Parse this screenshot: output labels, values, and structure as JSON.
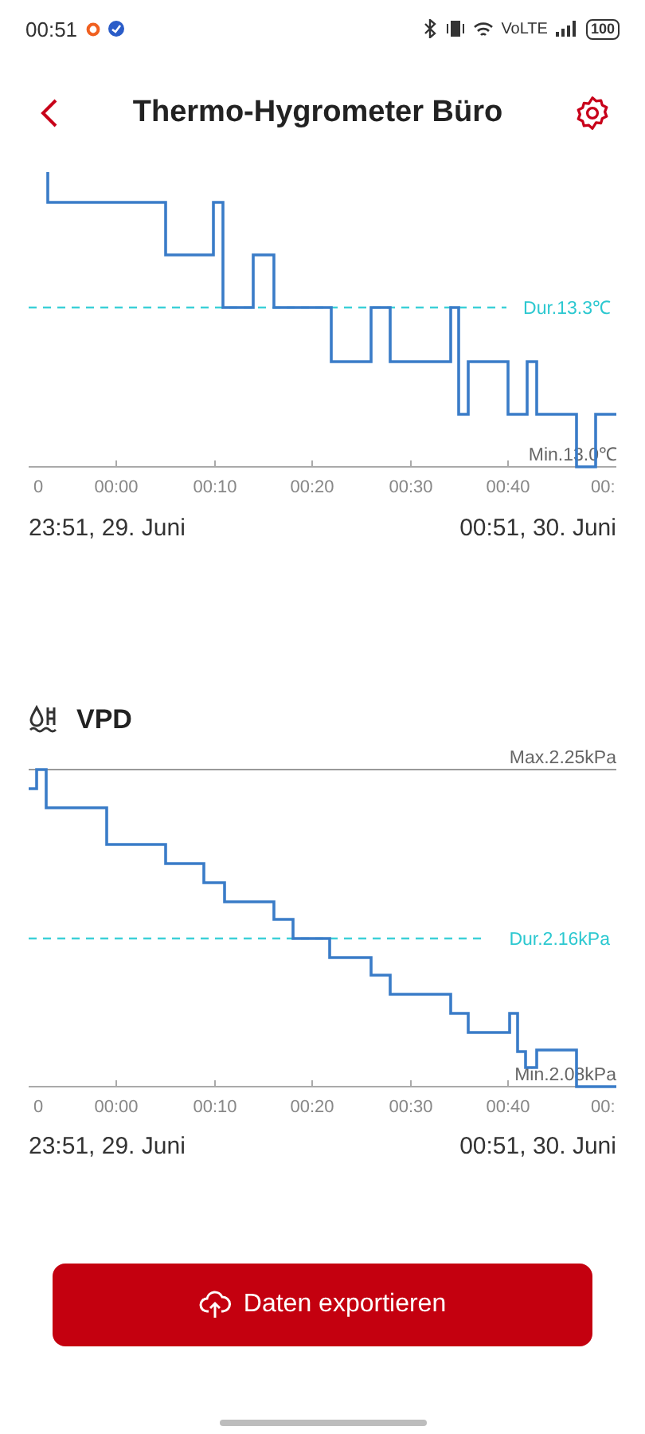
{
  "status_bar": {
    "time": "00:51",
    "network": "VoLTE",
    "battery": "100"
  },
  "header": {
    "title": "Thermo-Hygrometer Büro"
  },
  "charts": [
    {
      "kind": "temperature",
      "labels": [
        {
          "kind": "avg",
          "text": "Dur.13.3℃"
        },
        {
          "kind": "min",
          "text": "Min.13.0℃"
        }
      ],
      "xticks": [
        "0",
        "00:00",
        "00:10",
        "00:20",
        "00:30",
        "00:40",
        "00:"
      ],
      "start": "23:51, 29. Juni",
      "end": "00:51, 30. Juni"
    },
    {
      "kind": "vpd",
      "title": "VPD",
      "labels": [
        {
          "kind": "max",
          "text": "Max.2.25kPa"
        },
        {
          "kind": "avg",
          "text": "Dur.2.16kPa"
        },
        {
          "kind": "min",
          "text": "Min.2.08kPa"
        }
      ],
      "xticks": [
        "0",
        "00:00",
        "00:10",
        "00:20",
        "00:30",
        "00:40",
        "00:"
      ],
      "start": "23:51, 29. Juni",
      "end": "00:51, 30. Juni"
    }
  ],
  "export_button": {
    "label": "Daten exportieren"
  }
}
